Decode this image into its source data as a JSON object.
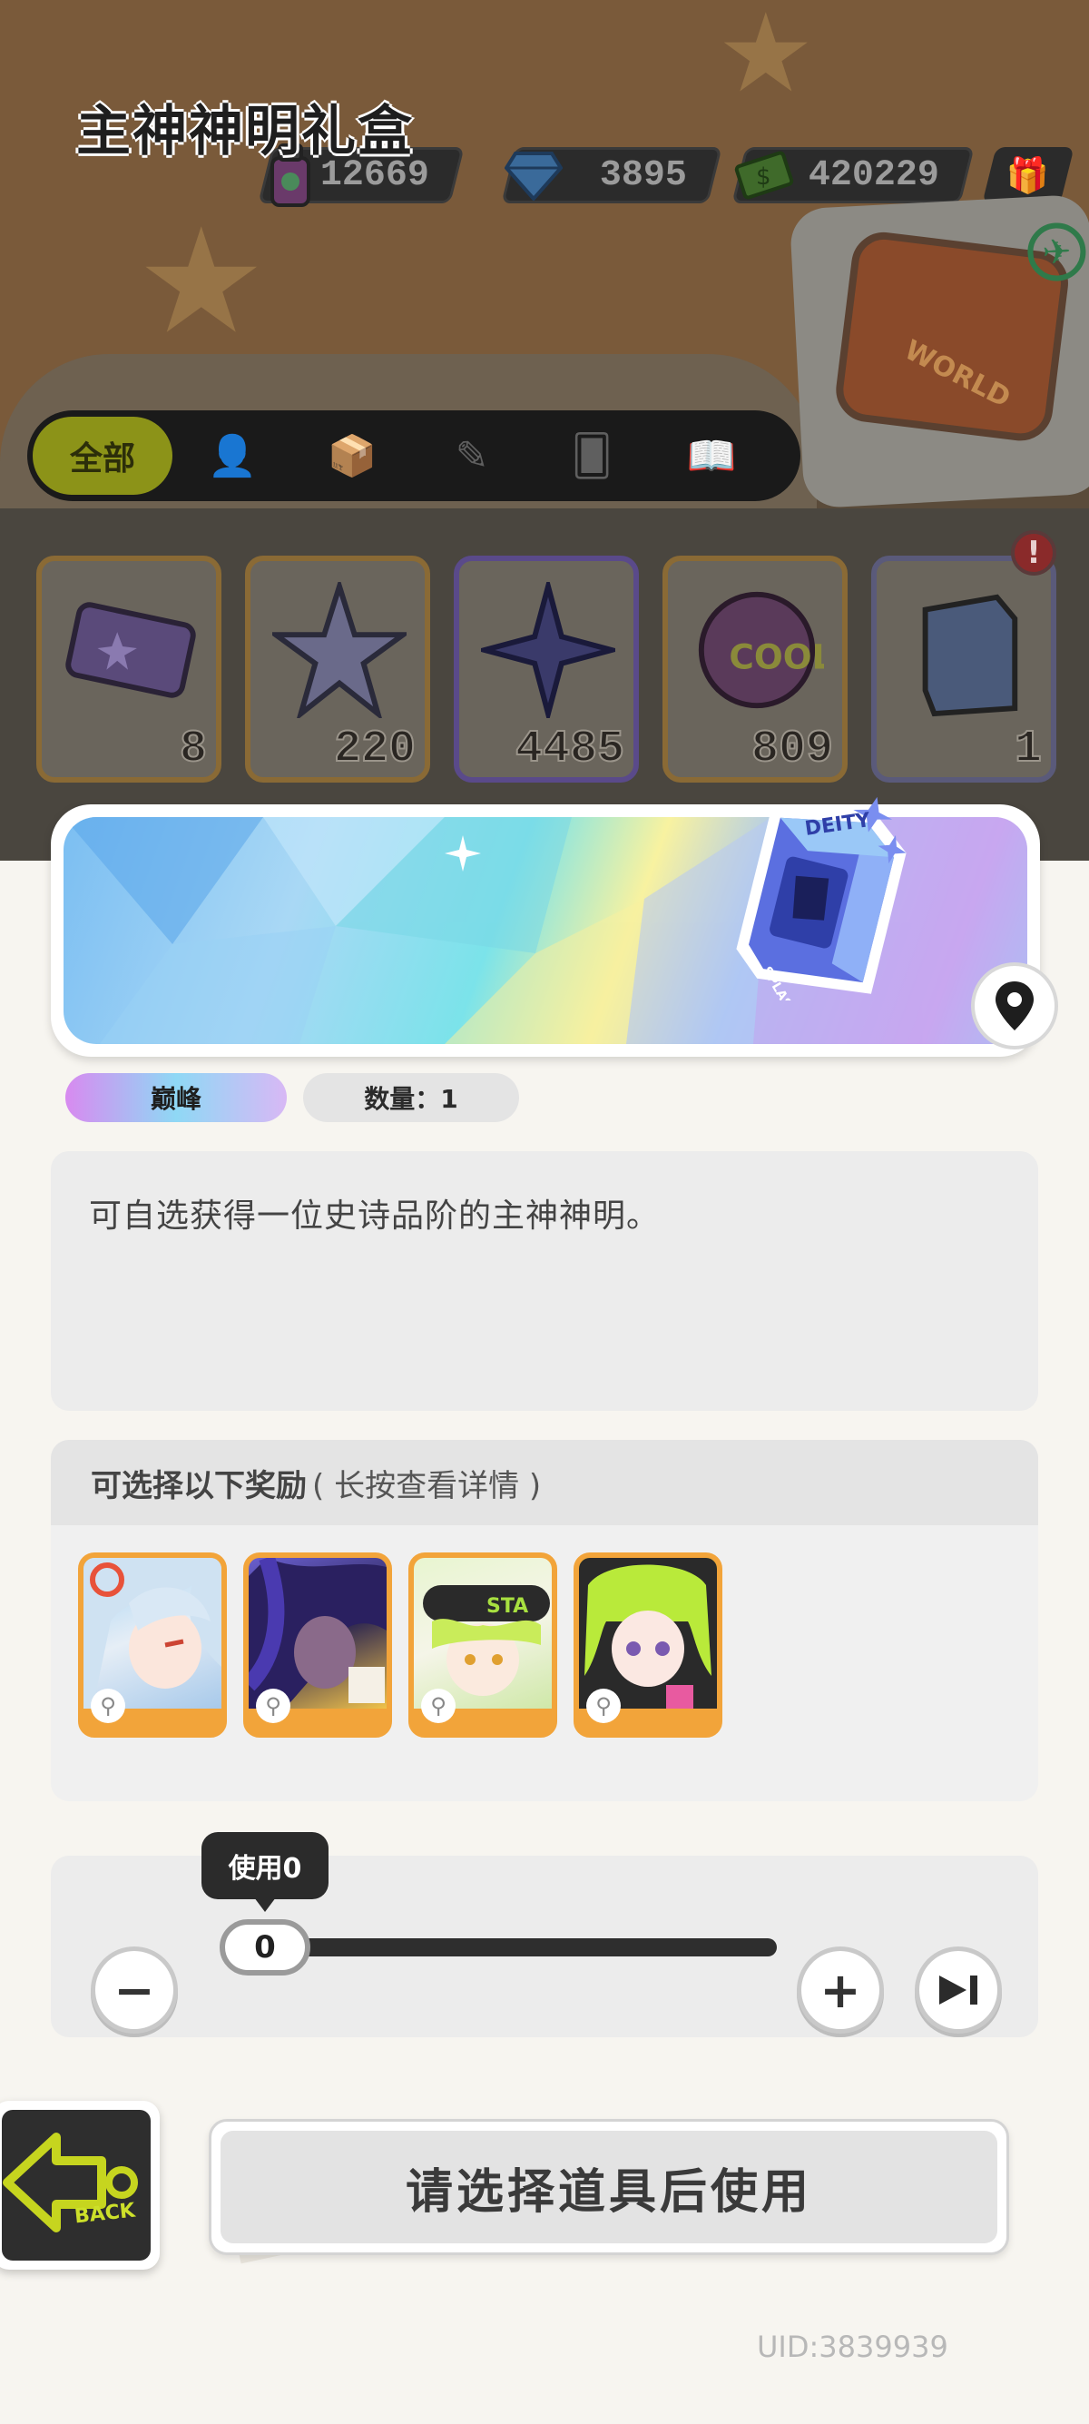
{
  "currencies": [
    {
      "icon": "spray-can-icon",
      "value": "12669"
    },
    {
      "icon": "diamond-icon",
      "value": "3895"
    },
    {
      "icon": "cash-icon",
      "value": "420229"
    }
  ],
  "tabs": [
    {
      "label": "全部",
      "icon": "all"
    },
    {
      "label": "",
      "icon": "person-icon"
    },
    {
      "label": "",
      "icon": "crate-icon"
    },
    {
      "label": "",
      "icon": "spray-icon"
    },
    {
      "label": "",
      "icon": "cards-icon"
    },
    {
      "label": "",
      "icon": "book-icon"
    }
  ],
  "inventory": [
    {
      "name": "ticket",
      "count": "8"
    },
    {
      "name": "rainbow-star",
      "count": "220"
    },
    {
      "name": "purple-star",
      "count": "4485"
    },
    {
      "name": "cool-orb",
      "count": "809"
    },
    {
      "name": "deity-box",
      "count": "1"
    }
  ],
  "notice_badge": "!",
  "world_card_label": "WORLD",
  "item": {
    "name": "主神神明礼盒",
    "rarity": "巅峰",
    "quantity": "数量：1",
    "description": "可自选获得一位史诗品阶的主神神明。",
    "box_label": "DEITY",
    "box_sub": "SPLASH"
  },
  "rewards": {
    "title": "可选择以下奖励",
    "hint": "( 长按查看详情 )",
    "count": 4
  },
  "use": {
    "tooltip": "使用0",
    "value": "0",
    "min": 0,
    "max": 1
  },
  "back_label": "BACK",
  "confirm_label": "请选择道具后使用",
  "uid": "UID:3839939",
  "colors": {
    "accent_green": "#c6d51f",
    "card_orange": "#f2a43a",
    "dark": "#2b2b2b"
  }
}
